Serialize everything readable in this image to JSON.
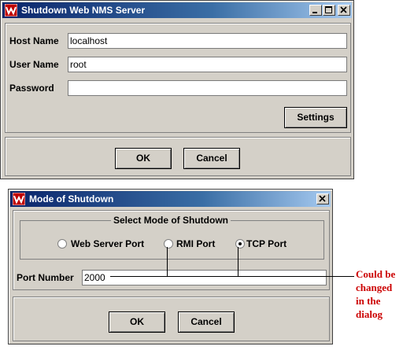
{
  "window1": {
    "title": "Shutdown Web NMS Server",
    "host_label": "Host Name",
    "host_value": "localhost",
    "user_label": "User Name",
    "user_value": "root",
    "password_label": "Password",
    "password_value": "",
    "settings_label": "Settings",
    "ok_label": "OK",
    "cancel_label": "Cancel"
  },
  "window2": {
    "title": "Mode of Shutdown",
    "group_title": "Select Mode of Shutdown",
    "modes": [
      {
        "label": "Web Server Port",
        "selected": false
      },
      {
        "label": "RMI Port",
        "selected": false
      },
      {
        "label": "TCP Port",
        "selected": true
      }
    ],
    "port_label": "Port Number",
    "port_value": "2000",
    "ok_label": "OK",
    "cancel_label": "Cancel"
  },
  "annotation": {
    "lines": [
      "Could be",
      "changed",
      "in the",
      "dialog"
    ],
    "color": "#cc0000"
  },
  "colors": {
    "title_start": "#0a246a",
    "title_end": "#a6caf0",
    "window_bg": "#d4d0c8"
  },
  "icons": {
    "app": "webnms-logo-icon",
    "minimize": "minimize-icon",
    "maximize": "maximize-icon",
    "close": "close-icon"
  }
}
